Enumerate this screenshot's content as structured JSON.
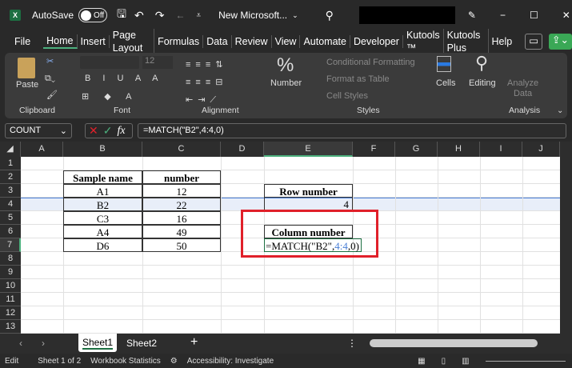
{
  "titlebar": {
    "autosave_label": "AutoSave",
    "autosave_state": "Off",
    "doc_title": "New Microsoft...",
    "app_color": "#1d6f42"
  },
  "menu": {
    "tabs": [
      "File",
      "Home",
      "Insert",
      "Page Layout",
      "Formulas",
      "Data",
      "Review",
      "View",
      "Automate",
      "Developer",
      "Kutools ™",
      "Kutools Plus",
      "Help"
    ],
    "active": "Home"
  },
  "ribbon": {
    "clipboard": {
      "paste": "Paste",
      "label": "Clipboard"
    },
    "font": {
      "size": "12",
      "label": "Font"
    },
    "alignment": {
      "label": "Alignment"
    },
    "number": {
      "label": "Number"
    },
    "styles": {
      "conditional": "Conditional Formatting",
      "format_table": "Format as Table",
      "cell_styles": "Cell Styles",
      "label": "Styles"
    },
    "cells": {
      "label": "Cells"
    },
    "editing": {
      "label": "Editing"
    },
    "analysis": {
      "analyze": "Analyze",
      "data": "Data",
      "label": "Analysis"
    }
  },
  "formula_bar": {
    "name_box": "COUNT",
    "formula": "=MATCH(\"B2\",4:4,0)"
  },
  "columns": [
    "A",
    "B",
    "C",
    "D",
    "E",
    "F",
    "G",
    "H",
    "I",
    "J"
  ],
  "rows": [
    "1",
    "2",
    "3",
    "4",
    "5",
    "6",
    "7",
    "8",
    "9",
    "10",
    "11",
    "12",
    "13"
  ],
  "table": {
    "headers": [
      "Sample name",
      "number"
    ],
    "rows": [
      [
        "A1",
        "12"
      ],
      [
        "B2",
        "22"
      ],
      [
        "C3",
        "16"
      ],
      [
        "A4",
        "49"
      ],
      [
        "D6",
        "50"
      ]
    ]
  },
  "row_number": {
    "label": "Row number",
    "value": "4"
  },
  "column_number": {
    "label": "Column number",
    "formula_prefix": "=MATCH(\"B2\",",
    "formula_ref": "4:4",
    "formula_suffix": ",0)"
  },
  "sheets": {
    "tabs": [
      "Sheet1",
      "Sheet2"
    ],
    "active": "Sheet1"
  },
  "status": {
    "mode": "Edit",
    "sheet_of": "Sheet 1 of 2",
    "workbook_stats": "Workbook Statistics",
    "accessibility": "Accessibility: Investigate"
  },
  "colors": {
    "highlight_box": "#e0202a",
    "row_highlight": "#4a7fd6",
    "ref_color": "#4a7fd6",
    "share_button": "#3aa856"
  }
}
